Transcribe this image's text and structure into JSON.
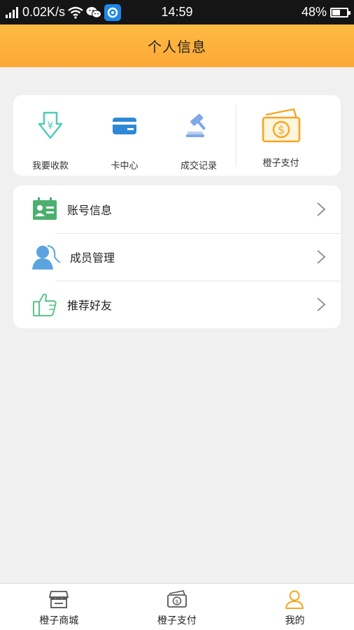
{
  "status_bar": {
    "speed": "0.02K/s",
    "time": "14:59",
    "battery_percent": "48%",
    "battery_level": 0.48,
    "icons": [
      "signal-icon",
      "wifi-icon",
      "wechat-icon",
      "app-notification-icon",
      "battery-icon"
    ]
  },
  "header": {
    "title": "个人信息"
  },
  "quick_actions": [
    {
      "label": "我要收款",
      "icon": "receive-payment-icon",
      "color": "#4ecbb8"
    },
    {
      "label": "卡中心",
      "icon": "card-icon",
      "color": "#2f88d6"
    },
    {
      "label": "成交记录",
      "icon": "gavel-icon",
      "color": "#7fa8e8"
    },
    {
      "label": "橙子支付",
      "icon": "money-icon",
      "color": "#f5a623"
    }
  ],
  "menu": [
    {
      "label": "账号信息",
      "icon": "id-card-icon",
      "color": "#4caf6e"
    },
    {
      "label": "成员管理",
      "icon": "member-icon",
      "color": "#5ba4e0"
    },
    {
      "label": "推荐好友",
      "icon": "thumb-up-icon",
      "color": "#5ec48a"
    }
  ],
  "tab_bar": [
    {
      "label": "橙子商城",
      "icon": "store-icon",
      "active": false
    },
    {
      "label": "橙子支付",
      "icon": "money-icon",
      "active": false
    },
    {
      "label": "我的",
      "icon": "user-icon",
      "active": true
    }
  ],
  "colors": {
    "accent": "#fdb13c",
    "active_tab": "#f5a623",
    "inactive_tab": "#555555"
  }
}
